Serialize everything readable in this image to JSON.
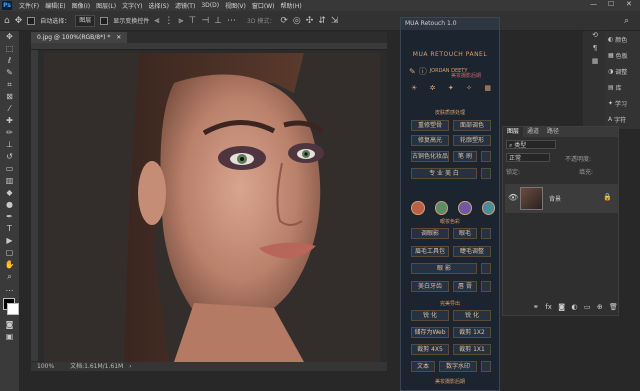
{
  "app": {
    "logo": "Ps"
  },
  "menu": [
    "文件(F)",
    "编辑(E)",
    "图像(I)",
    "图层(L)",
    "文字(Y)",
    "选择(S)",
    "滤镜(T)",
    "3D(D)",
    "视图(V)",
    "窗口(W)",
    "帮助(H)"
  ],
  "options": {
    "auto_select_label": "自动选择：",
    "auto_select_value": "图层",
    "show_transform_label": "显示变换控件",
    "mode_3d": "3D 模式："
  },
  "document": {
    "tab_title": "0.jpg @ 100%(RGB/8*) *",
    "zoom": "100%",
    "doc_size": "文档:1.61M/1.61M"
  },
  "plugin": {
    "window_title": "MUA Retouch 1.0",
    "header": "MUA RETOUCH PANEL",
    "brand": "JORDAN DEETY",
    "brand_sub": "美妆摄影后期",
    "section1": "皮肤质感处理",
    "buttons1": [
      "重修塑骨",
      "面部调色",
      "修复高光",
      "轮廓塑形",
      "古铜色化妆品",
      "笔 刷",
      "专 业 美 白"
    ],
    "section2": "眼妆色彩",
    "buttons2": [
      "调眼影",
      "眼毛",
      "眉毛工具包",
      "睫毛调整",
      "眼 影",
      "美白牙齿",
      "唇 膏"
    ],
    "section3": "完美导出",
    "buttons3": [
      "锐 化",
      "锐 化",
      "储存为Web",
      "裁剪 1X2",
      "裁剪 4X5",
      "裁剪 1X1",
      "文本",
      "数字水印"
    ],
    "footer": "美妆摄影后期"
  },
  "layers": {
    "tabs": [
      "图层",
      "通道",
      "路径"
    ],
    "filter_label": "类型",
    "blend_mode": "正常",
    "opacity_label": "不透明度:",
    "lock_label": "锁定:",
    "fill_label": "填充:",
    "layer_name": "背景"
  },
  "right_panel": [
    "颜色",
    "色板",
    "调整",
    "库",
    "学习",
    "字符"
  ],
  "colors": {
    "accent": "#d9a06b",
    "ps_blue": "#31a8ff",
    "panel_bg": "#1c2430"
  }
}
